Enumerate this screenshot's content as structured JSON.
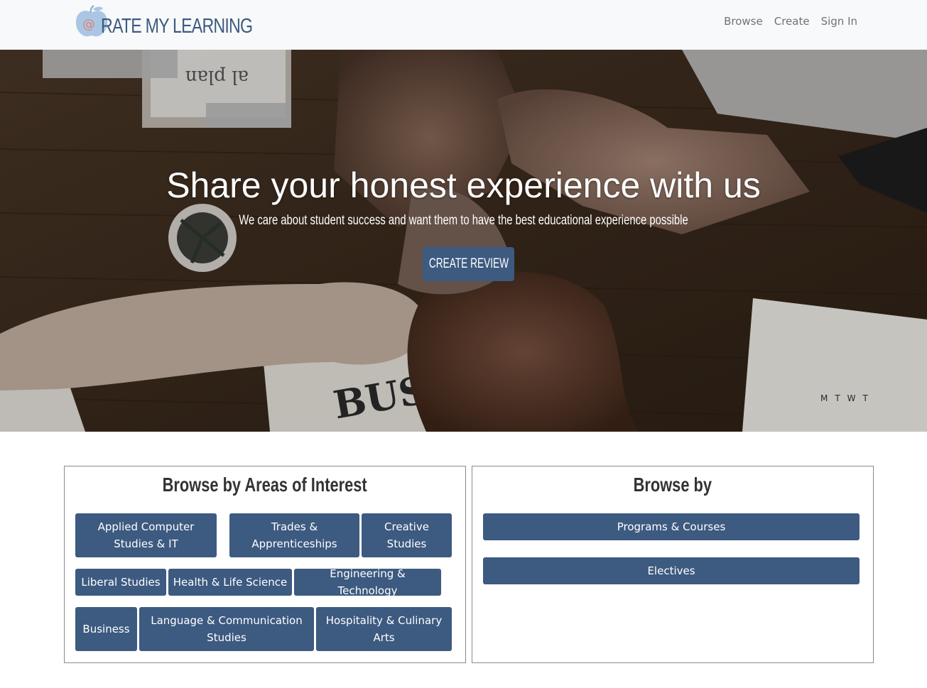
{
  "navbar": {
    "brand_text": "RATE MY LEARNING",
    "links": [
      "Browse",
      "Create",
      "Sign In"
    ]
  },
  "hero": {
    "title": "Share your honest experience with us",
    "subtitle": "We care about student success and want them to have the best educational experience possible",
    "cta_label": "CREATE REVIEW"
  },
  "areas": {
    "title": "Browse by Areas of Interest",
    "buttons": [
      "Applied Computer Studies & IT",
      "Trades & Apprenticeships",
      "Creative Studies",
      "Liberal Studies",
      "Health & Life Science",
      "Engineering & Technology",
      "Business",
      "Language & Communication Studies",
      "Hospitality & Culinary Arts"
    ]
  },
  "browse_by": {
    "title": "Browse by",
    "buttons": [
      "Programs & Courses",
      "Electives"
    ]
  },
  "colors": {
    "accent": "#3d5a80",
    "navbar_bg": "#f8f9fa",
    "nav_link": "#727272"
  }
}
